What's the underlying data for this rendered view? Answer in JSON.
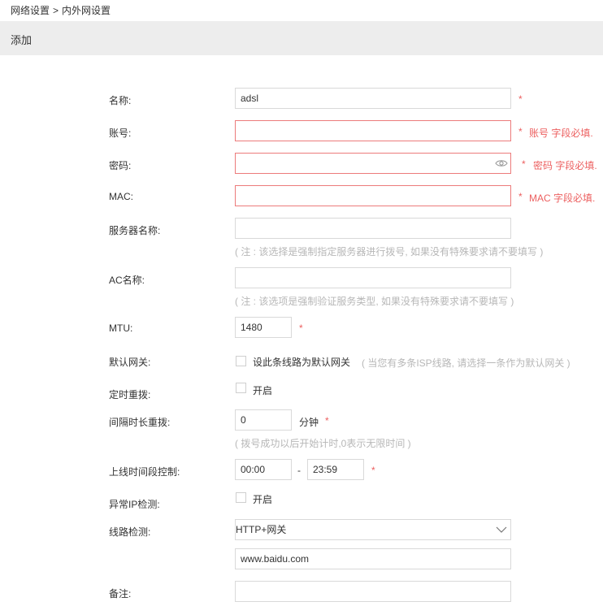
{
  "breadcrumb": {
    "parent": "网络设置",
    "separator": ">",
    "current": "内外网设置"
  },
  "section": {
    "title": "添加"
  },
  "form": {
    "name": {
      "label": "名称:",
      "value": "adsl",
      "required": "*"
    },
    "account": {
      "label": "账号:",
      "value": "",
      "required": "*",
      "error": "账号 字段必填."
    },
    "password": {
      "label": "密码:",
      "value": "",
      "required": "*",
      "error": "密码 字段必填.",
      "icon": "eye-icon"
    },
    "mac": {
      "label": "MAC:",
      "value": "",
      "required": "*",
      "error": "MAC 字段必填."
    },
    "server_name": {
      "label": "服务器名称:",
      "value": "",
      "hint": "( 注 : 该选择是强制指定服务器进行拨号, 如果没有特殊要求请不要填写 )"
    },
    "ac_name": {
      "label": "AC名称:",
      "value": "",
      "hint": "( 注 : 该选项是强制验证服务类型, 如果没有特殊要求请不要填写 )"
    },
    "mtu": {
      "label": "MTU:",
      "value": "1480",
      "required": "*"
    },
    "default_gateway": {
      "label": "默认网关:",
      "checkbox_label": "设此条线路为默认网关",
      "hint": "( 当您有多条ISP线路, 请选择一条作为默认网关 )",
      "checked": false
    },
    "timed_redial": {
      "label": "定时重拨:",
      "checkbox_label": "开启",
      "checked": false
    },
    "interval_redial": {
      "label": "间隔时长重拨:",
      "value": "0",
      "unit": "分钟",
      "required": "*",
      "hint": "( 拨号成功以后开始计时,0表示无限时间 )"
    },
    "online_period": {
      "label": "上线时间段控制:",
      "start": "00:00",
      "separator": "-",
      "end": "23:59",
      "required": "*"
    },
    "abnormal_ip": {
      "label": "异常IP检测:",
      "checkbox_label": "开启",
      "checked": false
    },
    "line_detection": {
      "label": "线路检测:",
      "selected": "HTTP+网关",
      "icon": "chevron-down-icon",
      "target": "www.baidu.com"
    },
    "remark": {
      "label": "备注:",
      "value": ""
    }
  },
  "colors": {
    "required": "#ec5f5f",
    "error_border": "#ec7b7b",
    "hint": "#b7b7b7",
    "header_bg": "#ededed"
  }
}
